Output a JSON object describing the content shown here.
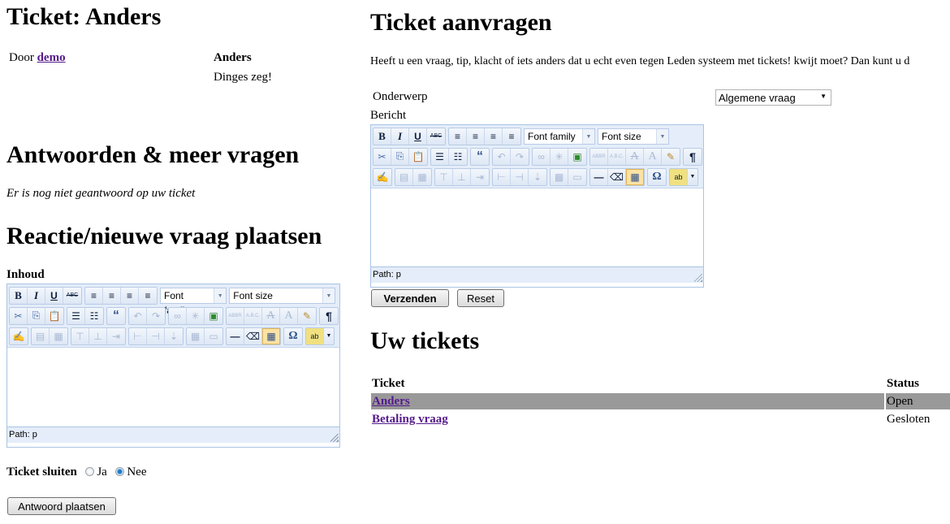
{
  "left": {
    "ticket_title": "Ticket: Anders",
    "door_label": "Door",
    "door_user": "demo",
    "ticket_subject": "Anders",
    "ticket_body": "Dinges zeg!",
    "answers_heading": "Antwoorden & meer vragen",
    "no_answer_text": "Er is nog niet geantwoord op uw ticket",
    "reply_heading": "Reactie/nieuwe vraag plaatsen",
    "content_label": "Inhoud",
    "close_ticket_label": "Ticket sluiten",
    "radio_yes": "Ja",
    "radio_no": "Nee",
    "radio_selected": "Nee",
    "submit_label": "Antwoord plaatsen"
  },
  "editor": {
    "font_family": "Font family",
    "font_size": "Font size",
    "path_label": "Path: p",
    "buttons": {
      "bold": "B",
      "italic": "I",
      "underline": "U",
      "strike": "ABC",
      "blockquote": "“",
      "pilcrow": "¶",
      "omega": "Ω",
      "abbr": "ABBR",
      "acronym": "A.B.C.",
      "font_a": "A"
    }
  },
  "right": {
    "heading": "Ticket aanvragen",
    "intro": "Heeft u een vraag, tip, klacht of iets anders dat u echt even tegen Leden systeem met tickets! kwijt moet? Dan kunt u d",
    "subject_label": "Onderwerp",
    "subject_value": "Algemene vraag",
    "message_label": "Bericht",
    "send_label": "Verzenden",
    "reset_label": "Reset",
    "tickets_heading": "Uw tickets",
    "table": {
      "headers": [
        "Ticket",
        "Status"
      ],
      "rows": [
        {
          "ticket": "Anders",
          "status": "Open"
        },
        {
          "ticket": "Betaling vraag",
          "status": "Gesloten"
        }
      ]
    }
  }
}
